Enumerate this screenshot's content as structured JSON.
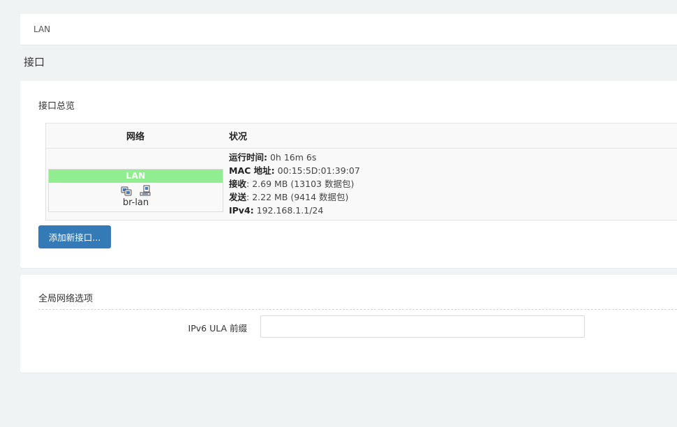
{
  "tabs": {
    "lan": "LAN"
  },
  "page": {
    "title": "接口"
  },
  "overview": {
    "title": "接口总览",
    "columns": {
      "network": "网络",
      "status": "状况"
    },
    "row": {
      "name": "LAN",
      "name_color": "#90ee90",
      "icons": [
        "ethernet-port-icon",
        "bridge-icon"
      ],
      "device": "br-lan",
      "status": {
        "uptime_label": "运行时间:",
        "uptime_value": " 0h 16m 6s",
        "mac_label": "MAC 地址:",
        "mac_value": " 00:15:5D:01:39:07",
        "rx_label": "接收",
        "rx_value": ": 2.69 MB (13103 数据包)",
        "tx_label": "发送",
        "tx_value": ": 2.22 MB (9414 数据包)",
        "ipv4_label": "IPv4:",
        "ipv4_value": " 192.168.1.1/24"
      }
    },
    "add_button": "添加新接口..."
  },
  "global": {
    "title": "全局网络选项",
    "ula_label": "IPv6 ULA 前缀",
    "ula_value": ""
  },
  "colors": {
    "primary_button": "#337ab7",
    "lan_badge": "#90ee90"
  }
}
